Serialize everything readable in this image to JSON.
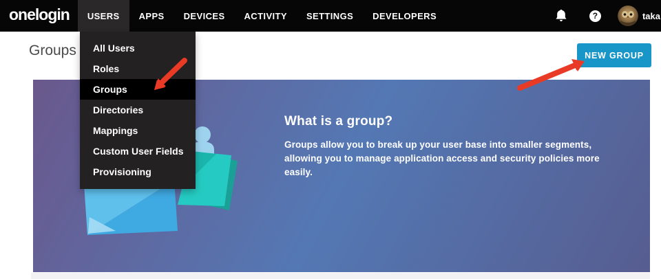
{
  "navbar": {
    "logo": "onelogin",
    "items": [
      {
        "label": "USERS",
        "active": true
      },
      {
        "label": "APPS",
        "active": false
      },
      {
        "label": "DEVICES",
        "active": false
      },
      {
        "label": "ACTIVITY",
        "active": false
      },
      {
        "label": "SETTINGS",
        "active": false
      },
      {
        "label": "DEVELOPERS",
        "active": false
      }
    ],
    "help_glyph": "?",
    "username": "taka"
  },
  "page": {
    "title": "Groups",
    "new_group_button": "NEW GROUP"
  },
  "users_menu": {
    "items": [
      "All Users",
      "Roles",
      "Groups",
      "Directories",
      "Mappings",
      "Custom User Fields",
      "Provisioning"
    ],
    "active_item": "Groups"
  },
  "banner": {
    "heading": "What is a group?",
    "body": "Groups allow you to break up your user base into smaller segments, allowing you to manage application access and security policies more easily."
  },
  "colors": {
    "navbar_bg": "#060606",
    "accent_blue": "#1996c8",
    "arrow_red": "#e93a26",
    "banner_gradient": [
      "#6a588c",
      "#5478b4",
      "#565d90"
    ],
    "illustration_teal": "#25cbc2",
    "illustration_blue": "#49b4e7"
  }
}
